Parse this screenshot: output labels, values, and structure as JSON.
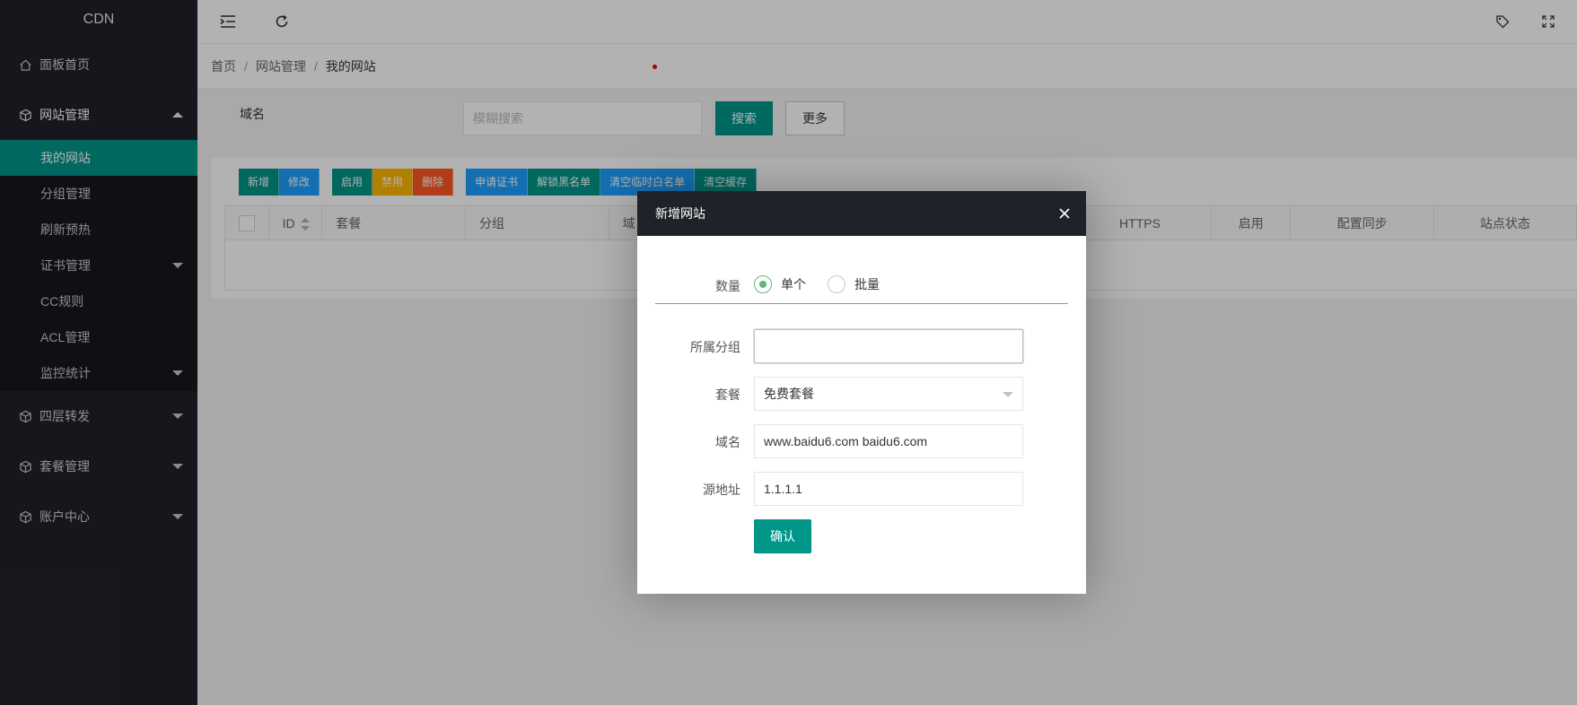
{
  "sidebar": {
    "logo": "CDN",
    "items": [
      {
        "label": "面板首页"
      },
      {
        "label": "网站管理"
      },
      {
        "label": "四层转发"
      },
      {
        "label": "套餐管理"
      },
      {
        "label": "账户中心"
      }
    ],
    "subitems": [
      {
        "label": "我的网站"
      },
      {
        "label": "分组管理"
      },
      {
        "label": "刷新预热"
      },
      {
        "label": "证书管理"
      },
      {
        "label": "CC规则"
      },
      {
        "label": "ACL管理"
      },
      {
        "label": "监控统计"
      }
    ]
  },
  "breadcrumb": {
    "home": "首页",
    "section": "网站管理",
    "current": "我的网站",
    "separator": "/"
  },
  "search": {
    "label": "域名",
    "placeholder": "模糊搜索",
    "search_button": "搜索",
    "more_button": "更多"
  },
  "toolbar": {
    "add": "新增",
    "edit": "修改",
    "enable": "启用",
    "disable": "禁用",
    "delete": "删除",
    "apply_cert": "申请证书",
    "unlock_blacklist": "解锁黑名单",
    "clear_temp_whitelist": "清空临时白名单",
    "clear_cache": "清空缓存"
  },
  "table": {
    "columns": [
      "ID",
      "套餐",
      "分组",
      "域",
      "HTTPS",
      "启用",
      "配置同步",
      "站点状态"
    ]
  },
  "modal": {
    "title": "新增网站",
    "quantity_label": "数量",
    "quantity_single": "单个",
    "quantity_batch": "批量",
    "group_label": "所属分组",
    "group_value": "",
    "plan_label": "套餐",
    "plan_value": "免费套餐",
    "domain_label": "域名",
    "domain_value": "www.baidu6.com baidu6.com",
    "origin_label": "源地址",
    "origin_value": "1.1.1.1",
    "confirm_button": "确认"
  }
}
